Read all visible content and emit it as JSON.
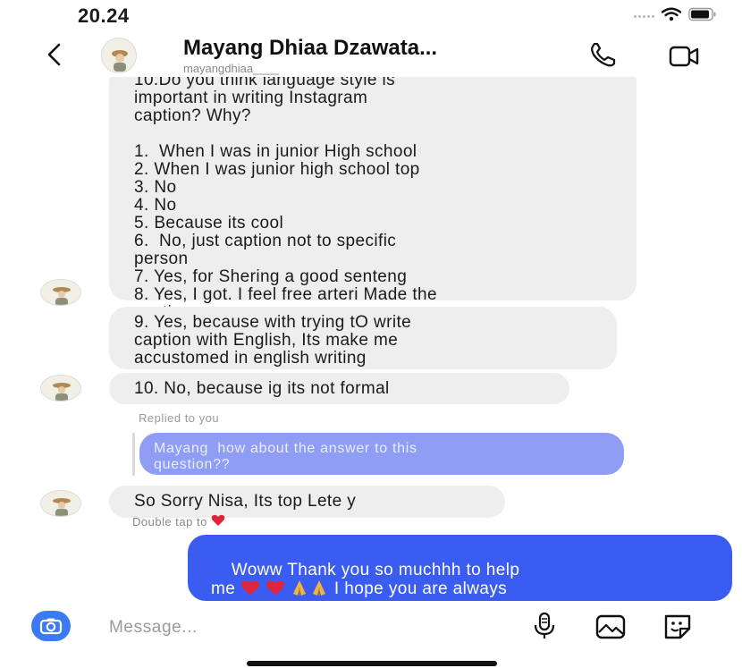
{
  "status_bar": {
    "time": "20.24"
  },
  "header": {
    "display_name": "Mayang Dhiaa Dzawata...",
    "username": "mayangdhiaa____"
  },
  "messages": {
    "block1": "10.Do you think language style is\nimportant in writing Instagram\ncaption? Why?\n\n1.  When I was in junior High school\n2. When I was junior high school top\n3. No\n4. No\n5. Because its cool\n6.  No, just caption not to specific\nperson\n7. Yes, for Shering a good senteng\n8. Yes, I got. I feel free arteri Made the\ncaption",
    "block2": "9. Yes, because with trying tO write\ncaption with English, Its make me\naccustomed in english writing",
    "block3": "10. No, because ig its not formal",
    "reply_label": "Replied to you",
    "quoted_message": "Mayang  how about the answer to this\nquestion??",
    "block4": "So Sorry Nisa, Its top Lete y",
    "double_tap_hint": "Double tap to",
    "outgoing_before": "Woww Thank you so muchhh to help\nme ",
    "outgoing_after": " I hope you are always\nhealthy and happy"
  },
  "composer": {
    "placeholder": "Message..."
  },
  "icons": {
    "back": "chevron-left-icon",
    "call": "phone-icon",
    "video": "video-camera-icon",
    "camera": "camera-icon",
    "mic": "microphone-icon",
    "gallery": "image-icon",
    "sticker": "sticker-icon",
    "heart": "heart-icon",
    "pray": "folded-hands-icon"
  },
  "colors": {
    "outgoing_bubble": "#3b5cf0",
    "quoted_bubble": "#8f9ef4",
    "incoming_bubble": "#eeeeee",
    "camera_button": "#3a7af2",
    "heart": "#e0243c"
  }
}
